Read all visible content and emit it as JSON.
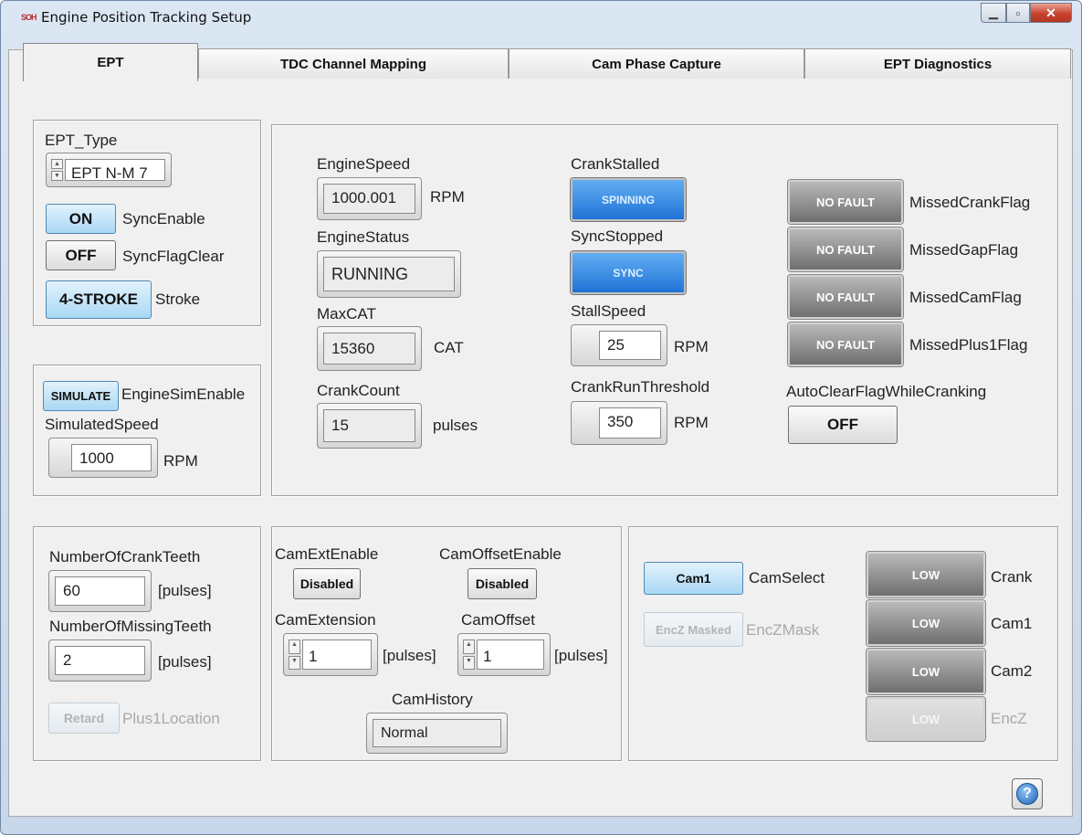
{
  "window": {
    "title": "Engine Position Tracking Setup",
    "app_icon_text": "SOH"
  },
  "tabs": [
    "EPT",
    "TDC Channel Mapping",
    "Cam Phase Capture",
    "EPT Diagnostics"
  ],
  "ept_type": {
    "label": "EPT_Type",
    "value": "EPT N-M 7",
    "sync_enable": {
      "button": "ON",
      "label": "SyncEnable"
    },
    "sync_flag_clear": {
      "button": "OFF",
      "label": "SyncFlagClear"
    },
    "stroke": {
      "button": "4-STROKE",
      "label": "Stroke"
    }
  },
  "simulation": {
    "enable": {
      "button": "SIMULATE",
      "label": "EngineSimEnable"
    },
    "speed_label": "SimulatedSpeed",
    "speed_value": "1000",
    "speed_unit": "RPM"
  },
  "status": {
    "engine_speed": {
      "label": "EngineSpeed",
      "value": "1000.001",
      "unit": "RPM"
    },
    "engine_status": {
      "label": "EngineStatus",
      "value": "RUNNING"
    },
    "max_cat": {
      "label": "MaxCAT",
      "value": "15360",
      "unit": "CAT"
    },
    "crank_count": {
      "label": "CrankCount",
      "value": "15",
      "unit": "pulses"
    },
    "crank_stalled": {
      "label": "CrankStalled",
      "indicator": "SPINNING"
    },
    "sync_stopped": {
      "label": "SyncStopped",
      "indicator": "SYNC"
    },
    "stall_speed": {
      "label": "StallSpeed",
      "value": "25",
      "unit": "RPM"
    },
    "crank_run_threshold": {
      "label": "CrankRunThreshold",
      "value": "350",
      "unit": "RPM"
    },
    "flags": [
      {
        "indicator": "NO FAULT",
        "label": "MissedCrankFlag"
      },
      {
        "indicator": "NO FAULT",
        "label": "MissedGapFlag"
      },
      {
        "indicator": "NO FAULT",
        "label": "MissedCamFlag"
      },
      {
        "indicator": "NO FAULT",
        "label": "MissedPlus1Flag"
      }
    ],
    "auto_clear": {
      "label": "AutoClearFlagWhileCranking",
      "button": "OFF"
    }
  },
  "teeth": {
    "crank_teeth": {
      "label": "NumberOfCrankTeeth",
      "value": "60",
      "unit": "[pulses]"
    },
    "missing_teeth": {
      "label": "NumberOfMissingTeeth",
      "value": "2",
      "unit": "[pulses]"
    },
    "plus1": {
      "button": "Retard",
      "label": "Plus1Location"
    }
  },
  "cam": {
    "ext_enable": {
      "label": "CamExtEnable",
      "button": "Disabled"
    },
    "offset_enable": {
      "label": "CamOffsetEnable",
      "button": "Disabled"
    },
    "extension": {
      "label": "CamExtension",
      "value": "1",
      "unit": "[pulses]"
    },
    "offset": {
      "label": "CamOffset",
      "value": "1",
      "unit": "[pulses]"
    },
    "history": {
      "label": "CamHistory",
      "value": "Normal"
    }
  },
  "signals": {
    "cam_select": {
      "button": "Cam1",
      "label": "CamSelect"
    },
    "encz_mask": {
      "button": "EncZ Masked",
      "label": "EncZMask"
    },
    "levels": [
      {
        "indicator": "LOW",
        "label": "Crank"
      },
      {
        "indicator": "LOW",
        "label": "Cam1"
      },
      {
        "indicator": "LOW",
        "label": "Cam2"
      },
      {
        "indicator": "LOW",
        "label": "EncZ"
      }
    ]
  }
}
